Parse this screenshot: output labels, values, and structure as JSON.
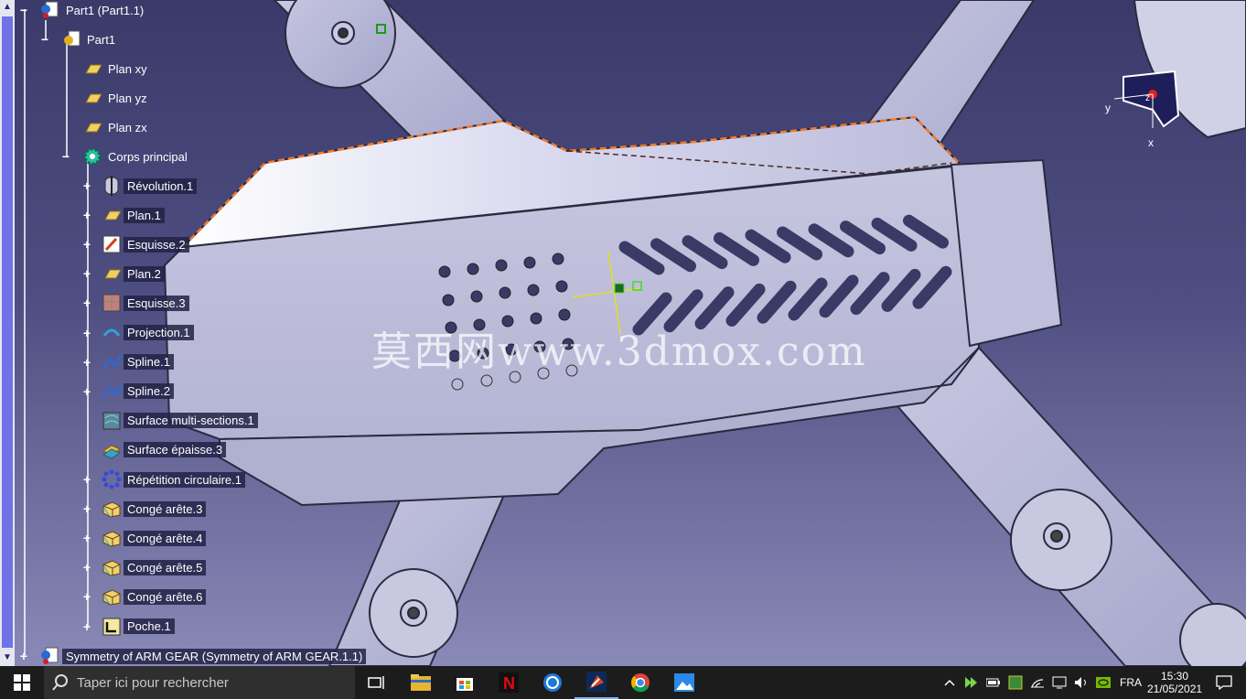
{
  "tree": {
    "root": "Part1 (Part1.1)",
    "part": "Part1",
    "planes": [
      "Plan xy",
      "Plan yz",
      "Plan zx"
    ],
    "body": "Corps principal",
    "features": [
      "Révolution.1",
      "Plan.1",
      "Esquisse.2",
      "Plan.2",
      "Esquisse.3",
      "Projection.1",
      "Spline.1",
      "Spline.2",
      "Surface multi-sections.1",
      "Surface épaisse.3",
      "Répétition circulaire.1",
      "Congé arête.3",
      "Congé arête.4",
      "Congé arête.5",
      "Congé arête.6",
      "Poche.1"
    ],
    "symmetry": "Symmetry of ARM GEAR (Symmetry of ARM GEAR.1.1)"
  },
  "compass": {
    "y": "y",
    "x": "x",
    "z": "z"
  },
  "watermark": "莫西网www.3dmox.com",
  "taskbar": {
    "search_placeholder": "Taper ici pour rechercher",
    "language": "FRA",
    "time": "15:30",
    "date": "21/05/2021"
  },
  "colors": {
    "tree_label_bg": "#222246",
    "part_face": "#c4c4de",
    "edge_highlight": "#f07a28",
    "taskbar": "#1c1c1c"
  }
}
